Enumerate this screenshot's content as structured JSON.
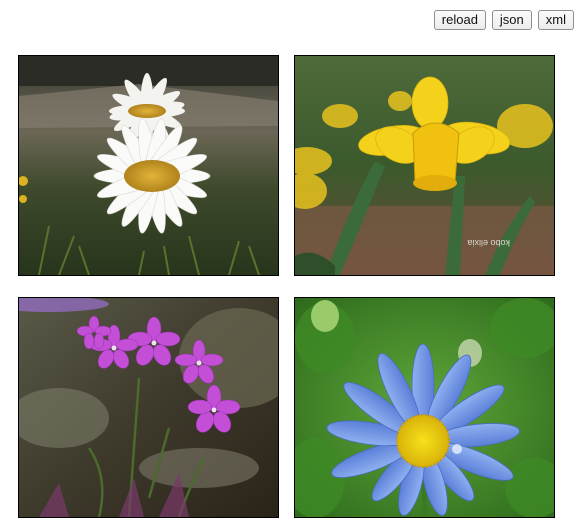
{
  "toolbar": {
    "reload_label": "reload",
    "json_label": "json",
    "xml_label": "xml"
  },
  "gallery": {
    "images": [
      {
        "subject": "white-daisy-photo"
      },
      {
        "subject": "yellow-daffodil-photo"
      },
      {
        "subject": "pink-phlox-photo"
      },
      {
        "subject": "blue-daisy-photo"
      }
    ],
    "watermark_text": "kobo elixia"
  }
}
